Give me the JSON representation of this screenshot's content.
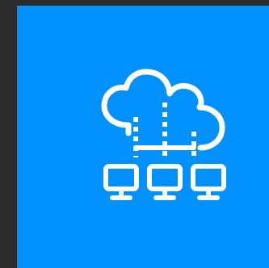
{
  "tile": {
    "background": "#0091ff",
    "icon": "cloud-network-icon",
    "icon_color": "#ffffff"
  },
  "page": {
    "background": "#2b2b2b"
  }
}
